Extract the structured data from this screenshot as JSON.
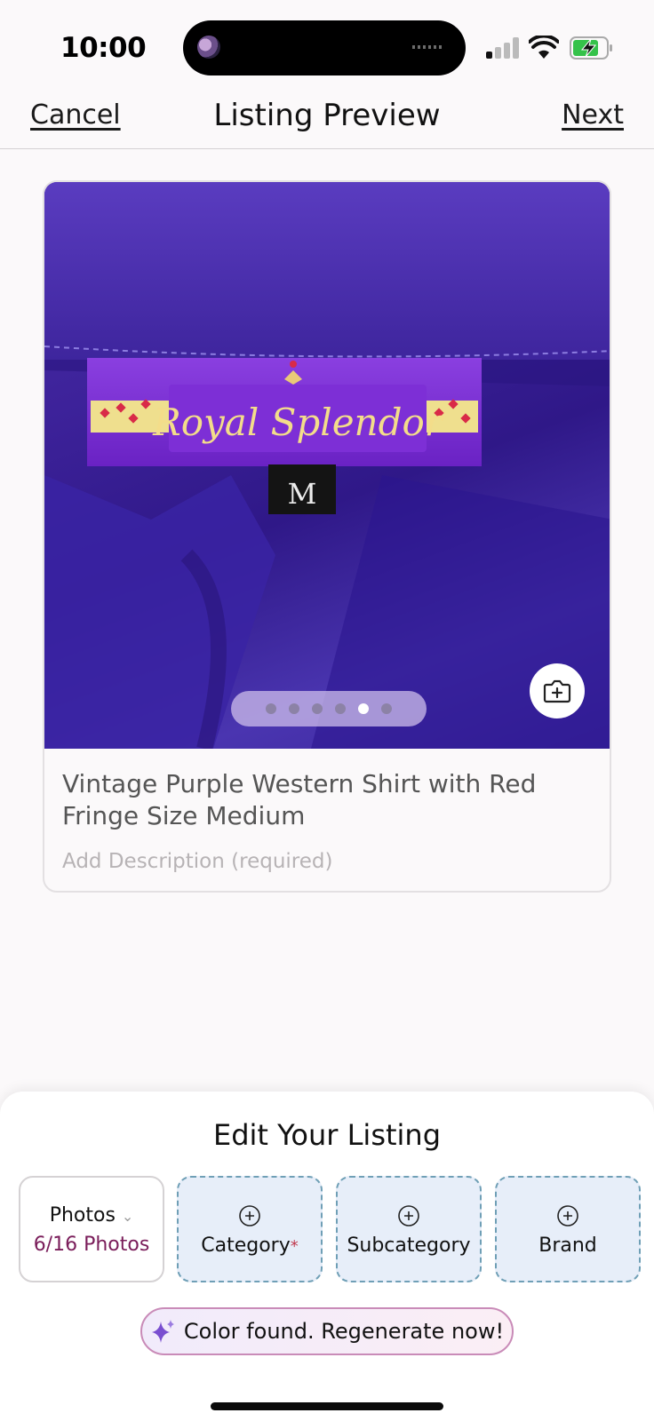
{
  "status_bar": {
    "time": "10:00",
    "icons": [
      "signal-icon",
      "wifi-icon",
      "battery-charging-icon"
    ]
  },
  "nav": {
    "cancel": "Cancel",
    "title": "Listing Preview",
    "next": "Next"
  },
  "listing": {
    "photo_label_brand_text": "Royal Splendor",
    "photo_size_tag": "M",
    "photo_count": 6,
    "active_photo_index": 5,
    "title": "Vintage Purple Western Shirt with Red Fringe Size Medium",
    "description_placeholder": "Add Description (required)"
  },
  "edit_sheet": {
    "title": "Edit Your Listing",
    "tiles": [
      {
        "label": "Photos",
        "sub": "6/16 Photos"
      },
      {
        "label": "Category",
        "required_mark": "*"
      },
      {
        "label": "Subcategory"
      },
      {
        "label": "Brand"
      }
    ],
    "regenerate": "Color found. Regenerate now!"
  },
  "colors": {
    "accent": "#7a1d5a",
    "tile_dashed_bg": "#e7eef9",
    "tile_dashed_border": "#6f9fb6",
    "photo_purple": "#3d229a"
  }
}
